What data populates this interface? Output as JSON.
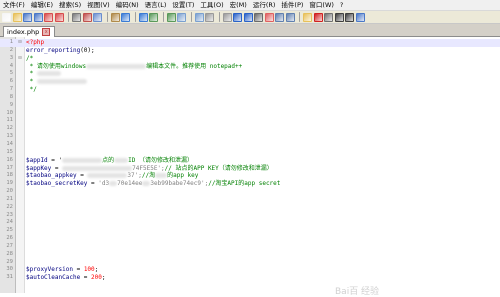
{
  "menu": [
    "文件(F)",
    "编辑(E)",
    "搜索(S)",
    "视图(V)",
    "编码(N)",
    "语言(L)",
    "设置(T)",
    "工具(O)",
    "宏(M)",
    "运行(R)",
    "插件(P)",
    "窗口(W)",
    "?"
  ],
  "toolbar_icons": [
    "new-file-icon",
    "open-file-icon",
    "save-icon",
    "save-all-icon",
    "close-icon",
    "close-all-icon",
    "print-icon",
    "cut-icon",
    "copy-icon",
    "paste-icon",
    "undo-icon",
    "redo-icon",
    "find-icon",
    "replace-icon",
    "zoom-in-icon",
    "zoom-out-icon",
    "sync-v-icon",
    "sync-h-icon",
    "word-wrap-icon",
    "show-all-chars-icon",
    "indent-guide-icon",
    "lang-icon",
    "doc-map-icon",
    "func-list-icon",
    "folder-icon",
    "record-macro-icon",
    "stop-macro-icon",
    "play-macro-icon",
    "run-multiple-icon",
    "save-macro-icon"
  ],
  "tab": {
    "name": "index.php"
  },
  "lines": [
    {
      "n": "1",
      "fold": "⊟",
      "parts": [
        [
          "php",
          "<?php"
        ]
      ]
    },
    {
      "n": "2",
      "parts": [
        [
          "fn",
          "error_reporting"
        ],
        [
          "txt",
          "(0);"
        ]
      ]
    },
    {
      "n": "3",
      "fold": "⊟",
      "parts": [
        [
          "cm",
          "/*"
        ]
      ]
    },
    {
      "n": "4",
      "parts": [
        [
          "cm",
          " * 请勿使用windows"
        ],
        [
          "blur",
          "60"
        ],
        [
          "cm",
          "编辑本文件。推荐使用 notepad++"
        ]
      ]
    },
    {
      "n": "5",
      "parts": [
        [
          "cm",
          " * "
        ],
        [
          "blur",
          "24"
        ]
      ]
    },
    {
      "n": "6",
      "parts": [
        [
          "cm",
          " * "
        ],
        [
          "blur",
          "50"
        ]
      ]
    },
    {
      "n": "7",
      "parts": [
        [
          "cm",
          " */"
        ]
      ]
    },
    {
      "n": "8",
      "parts": []
    },
    {
      "n": "9",
      "parts": []
    },
    {
      "n": "10",
      "parts": []
    },
    {
      "n": "11",
      "parts": []
    },
    {
      "n": "12",
      "parts": []
    },
    {
      "n": "13",
      "parts": []
    },
    {
      "n": "14",
      "parts": []
    },
    {
      "n": "15",
      "parts": []
    },
    {
      "n": "16",
      "parts": [
        [
          "var",
          "$appId"
        ],
        [
          "txt",
          " = '"
        ],
        [
          "blur",
          "40"
        ],
        [
          "cm",
          "点的"
        ],
        [
          "blur",
          "14"
        ],
        [
          "cm",
          "ID （请勿修改和泄漏）"
        ]
      ]
    },
    {
      "n": "17",
      "parts": [
        [
          "var",
          "$appKey"
        ],
        [
          "txt",
          " = "
        ],
        [
          "blur",
          "70"
        ],
        [
          "str",
          "74F5E5E';"
        ],
        [
          "cm",
          "// 站点的APP KEY（请勿修改和泄漏）"
        ]
      ]
    },
    {
      "n": "18",
      "parts": [
        [
          "var",
          "$taobao_appkey"
        ],
        [
          "txt",
          " = "
        ],
        [
          "blur",
          "40"
        ],
        [
          "str",
          "37';"
        ],
        [
          "cm",
          "//淘"
        ],
        [
          "blur",
          "12"
        ],
        [
          "cm",
          "的app key"
        ]
      ]
    },
    {
      "n": "19",
      "parts": [
        [
          "var",
          "$taobao_secretKey"
        ],
        [
          "txt",
          " = "
        ],
        [
          "str",
          "'d3"
        ],
        [
          "blur",
          "8"
        ],
        [
          "str",
          "70e14ee"
        ],
        [
          "blur",
          "8"
        ],
        [
          "str",
          "3eb99babe74ec9';"
        ],
        [
          "cm",
          "//淘宝API的app secret"
        ]
      ]
    },
    {
      "n": "20",
      "parts": []
    },
    {
      "n": "21",
      "parts": []
    },
    {
      "n": "22",
      "parts": []
    },
    {
      "n": "23",
      "parts": []
    },
    {
      "n": "24",
      "parts": []
    },
    {
      "n": "25",
      "parts": []
    },
    {
      "n": "26",
      "parts": []
    },
    {
      "n": "27",
      "parts": []
    },
    {
      "n": "28",
      "parts": []
    },
    {
      "n": "29",
      "parts": []
    },
    {
      "n": "30",
      "parts": [
        [
          "var",
          "$proxyVersion"
        ],
        [
          "txt",
          " = "
        ],
        [
          "num",
          "100"
        ],
        [
          "txt",
          ";"
        ]
      ]
    },
    {
      "n": "31",
      "parts": [
        [
          "var",
          "$autoCleanCache"
        ],
        [
          "txt",
          " = "
        ],
        [
          "num",
          "200"
        ],
        [
          "txt",
          ";"
        ]
      ]
    }
  ],
  "current_line": "1",
  "colors": {
    "comment": "#008000",
    "php_tag": "#ff0000",
    "variable": "#000080",
    "number": "#ff0000",
    "gutter": "#e4e4e4"
  },
  "watermark": "Bai百 经验"
}
